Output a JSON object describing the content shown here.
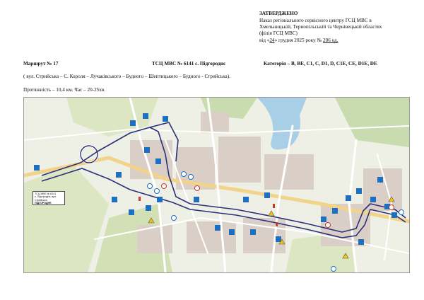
{
  "approval": {
    "title": "ЗАТВЕРДЖЕНО",
    "line1": "Наказ  регіонального сервісного центру ГСЦ МВС в",
    "line2": "Хмельницькій, Тернопільській та Чернівецькій областях",
    "line3": "(філія ГСЦ МВС)",
    "date_prefix": "від «",
    "day": "24",
    "month_text": "» грудня 2025 року   №",
    "number": "206 од."
  },
  "route": {
    "label": "Маршрут № 17",
    "center": "ТСЦ МВС № 6141 с. Підгороднє",
    "categories": "Категорія – B, BE, C1, C, D1, D, C1E, CE, D1E, DE",
    "streets": "( вул. Стрийська – С. Короля – Лучаківського – Будного – Шептицького – Будного - Стрийська).",
    "length_time": "Протяжність – 10,4 км.      Час – 20-25хв."
  },
  "map": {
    "legend_lines": [
      "ТСЦ МВС № 6141",
      "с. Підгороднє, вул. Стрийська",
      "ПІДГОРОДНЄ"
    ],
    "colors": {
      "route": "#2c2f7a",
      "road": "#ffffff",
      "road_major": "#f2d38a",
      "building": "#d9cfc6",
      "green": "#c9dcb0",
      "field": "#dde6c2",
      "water": "#a9cfe6",
      "sign": "#1d6fc2"
    }
  }
}
